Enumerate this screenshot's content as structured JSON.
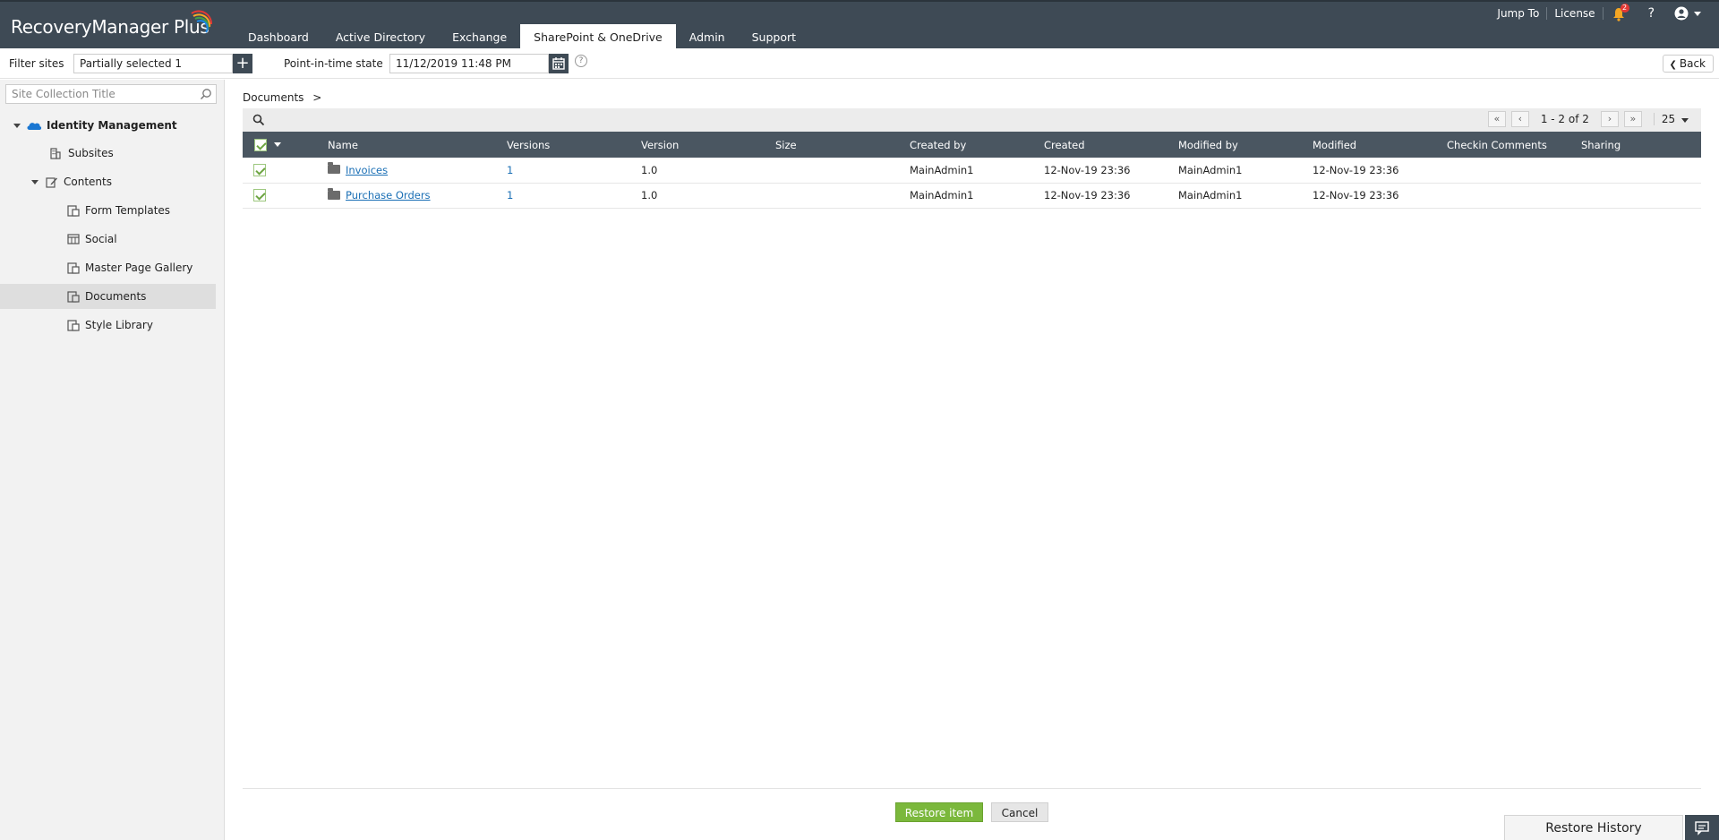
{
  "app": {
    "title": "RecoveryManager Plus"
  },
  "nav": {
    "tabs": [
      {
        "label": "Dashboard"
      },
      {
        "label": "Active Directory"
      },
      {
        "label": "Exchange"
      },
      {
        "label": "SharePoint & OneDrive"
      },
      {
        "label": "Admin"
      },
      {
        "label": "Support"
      }
    ],
    "active_tab": "SharePoint & OneDrive"
  },
  "topright": {
    "jump_to": "Jump To",
    "license": "License",
    "notification_count": "2",
    "help": "?"
  },
  "filter": {
    "filter_sites_label": "Filter sites",
    "filter_sites_value": "Partially selected 1",
    "pit_label": "Point-in-time state",
    "pit_value": "11/12/2019 11:48 PM",
    "back_label": "Back"
  },
  "sidebar": {
    "search_placeholder": "Site Collection Title",
    "root": "Identity Management",
    "items": [
      {
        "label": "Subsites"
      },
      {
        "label": "Contents"
      },
      {
        "label": "Form Templates"
      },
      {
        "label": "Social"
      },
      {
        "label": "Master Page Gallery"
      },
      {
        "label": "Documents"
      },
      {
        "label": "Style Library"
      }
    ],
    "selected": "Documents"
  },
  "main": {
    "breadcrumb": "Documents",
    "breadcrumb_sep": ">",
    "pager": {
      "text": "1 - 2 of 2",
      "page_size": "25"
    },
    "columns": [
      "Name",
      "Versions",
      "Version",
      "Size",
      "Created by",
      "Created",
      "Modified by",
      "Modified",
      "Checkin Comments",
      "Sharing"
    ],
    "rows": [
      {
        "name": "Invoices",
        "versions": "1",
        "version": "1.0",
        "size": "",
        "created_by": "MainAdmin1",
        "created": "12-Nov-19 23:36",
        "modified_by": "MainAdmin1",
        "modified": "12-Nov-19 23:36",
        "checkin": "",
        "sharing": ""
      },
      {
        "name": "Purchase Orders",
        "versions": "1",
        "version": "1.0",
        "size": "",
        "created_by": "MainAdmin1",
        "created": "12-Nov-19 23:36",
        "modified_by": "MainAdmin1",
        "modified": "12-Nov-19 23:36",
        "checkin": "",
        "sharing": ""
      }
    ]
  },
  "actions": {
    "restore_label": "Restore item",
    "cancel_label": "Cancel",
    "history_label": "Restore History"
  },
  "colors": {
    "header_bg": "#3e4a55",
    "table_head_bg": "#4a5661",
    "accent_green": "#7bb83c",
    "link_blue": "#1a6fb5"
  }
}
